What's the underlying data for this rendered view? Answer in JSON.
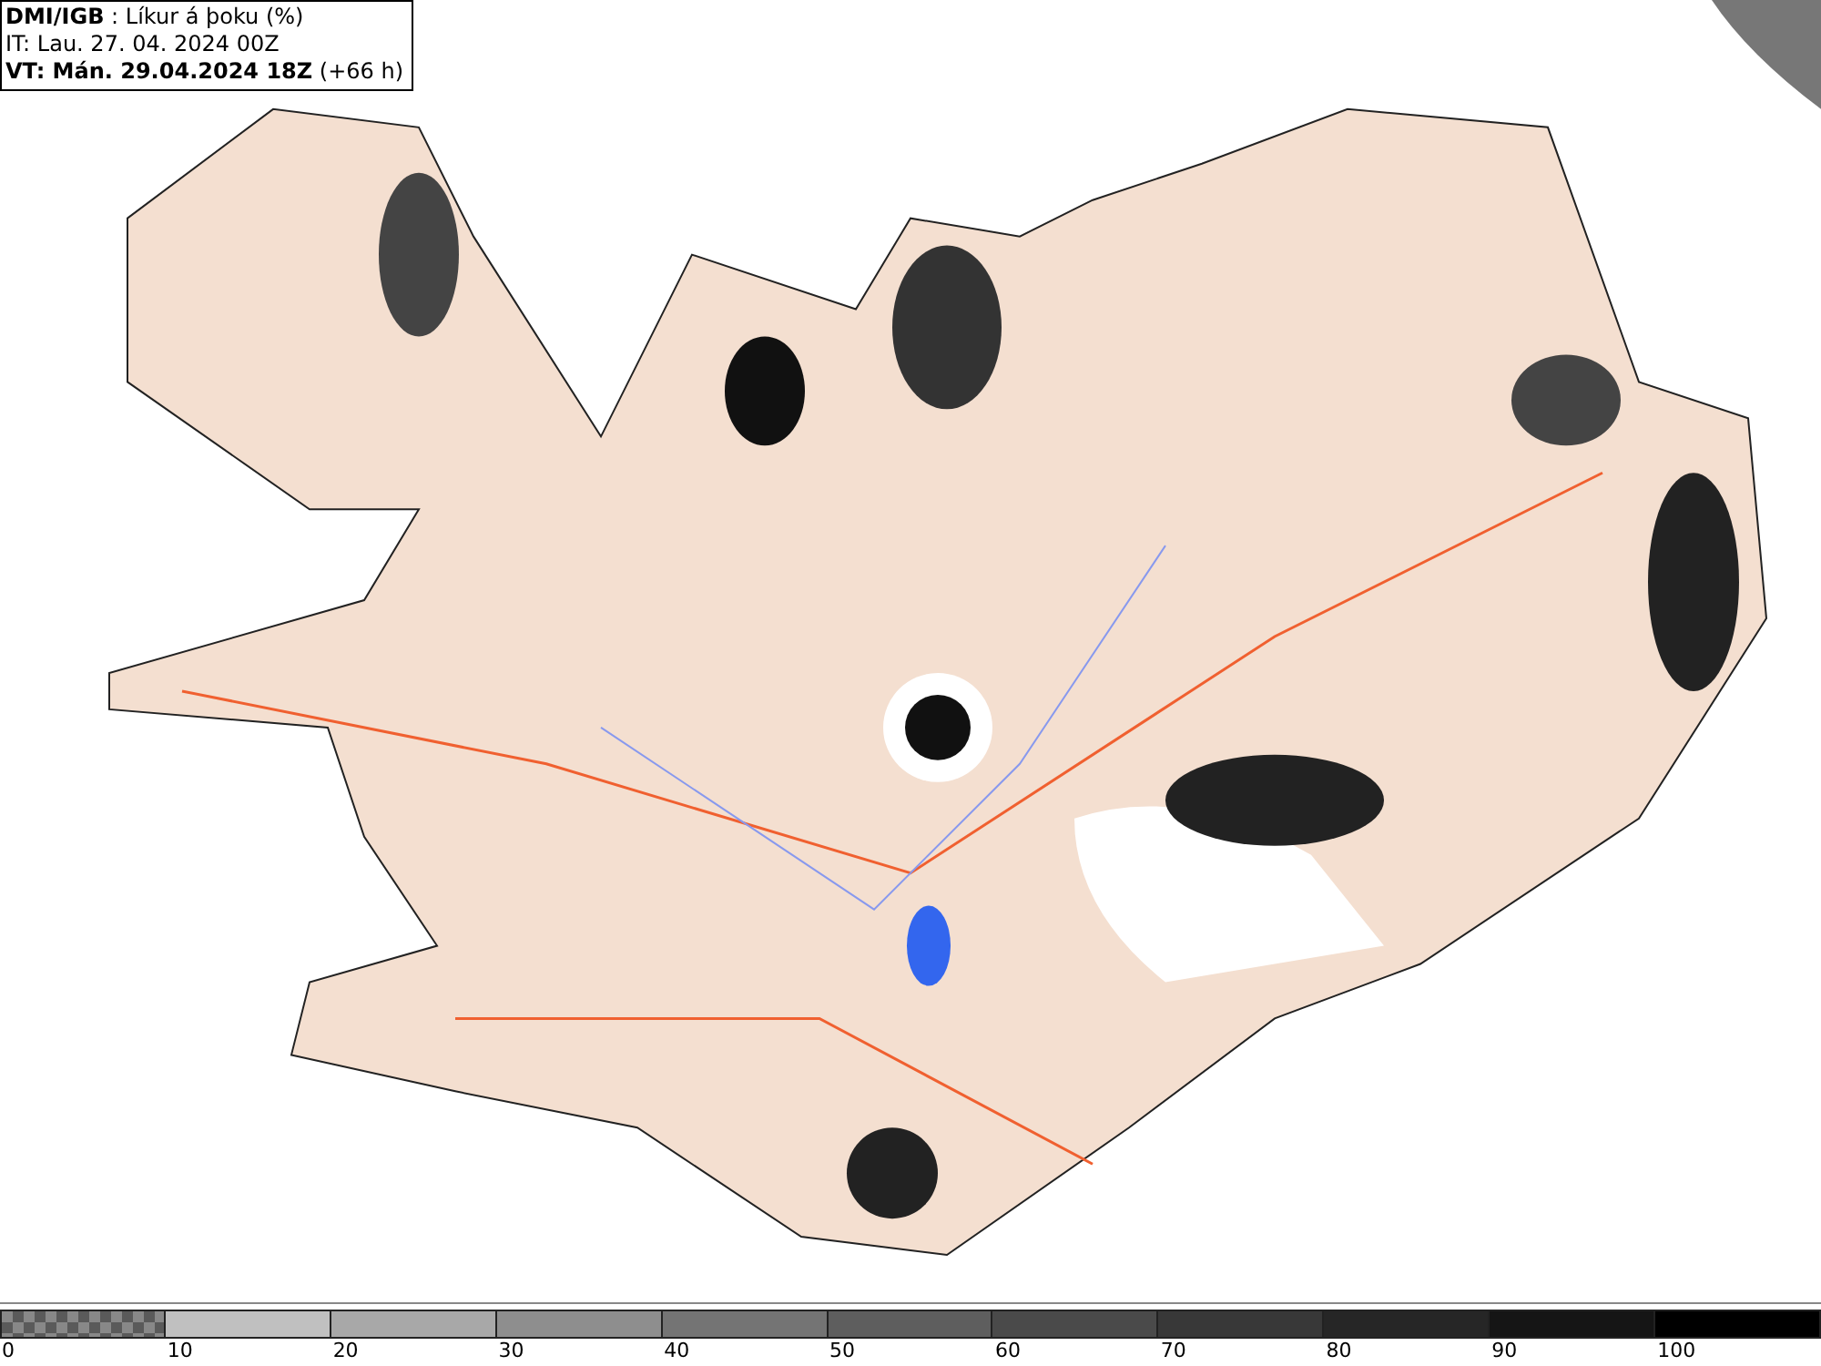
{
  "header": {
    "title": "**DMI/IGB** : Líkur á þoku (%)",
    "init_time": "IT: Lau. 27. 04. 2024 00Z",
    "valid_time": "**VT: Mán. 29.04.2024 18Z** (+66 h)"
  },
  "legend": [
    {
      "label": "0",
      "kind": "checker",
      "color": "#5a5a5a"
    },
    {
      "label": "10",
      "kind": "solid",
      "color": "#c0c0c0"
    },
    {
      "label": "20",
      "kind": "solid",
      "color": "#a8a8a8"
    },
    {
      "label": "30",
      "kind": "solid",
      "color": "#8e8e8e"
    },
    {
      "label": "40",
      "kind": "solid",
      "color": "#747474"
    },
    {
      "label": "50",
      "kind": "solid",
      "color": "#5e5e5e"
    },
    {
      "label": "60",
      "kind": "solid",
      "color": "#4a4a4a"
    },
    {
      "label": "70",
      "kind": "solid",
      "color": "#383838"
    },
    {
      "label": "80",
      "kind": "solid",
      "color": "#262626"
    },
    {
      "label": "90",
      "kind": "solid",
      "color": "#151515"
    },
    {
      "label": "100",
      "kind": "solid",
      "color": "#000000"
    }
  ]
}
